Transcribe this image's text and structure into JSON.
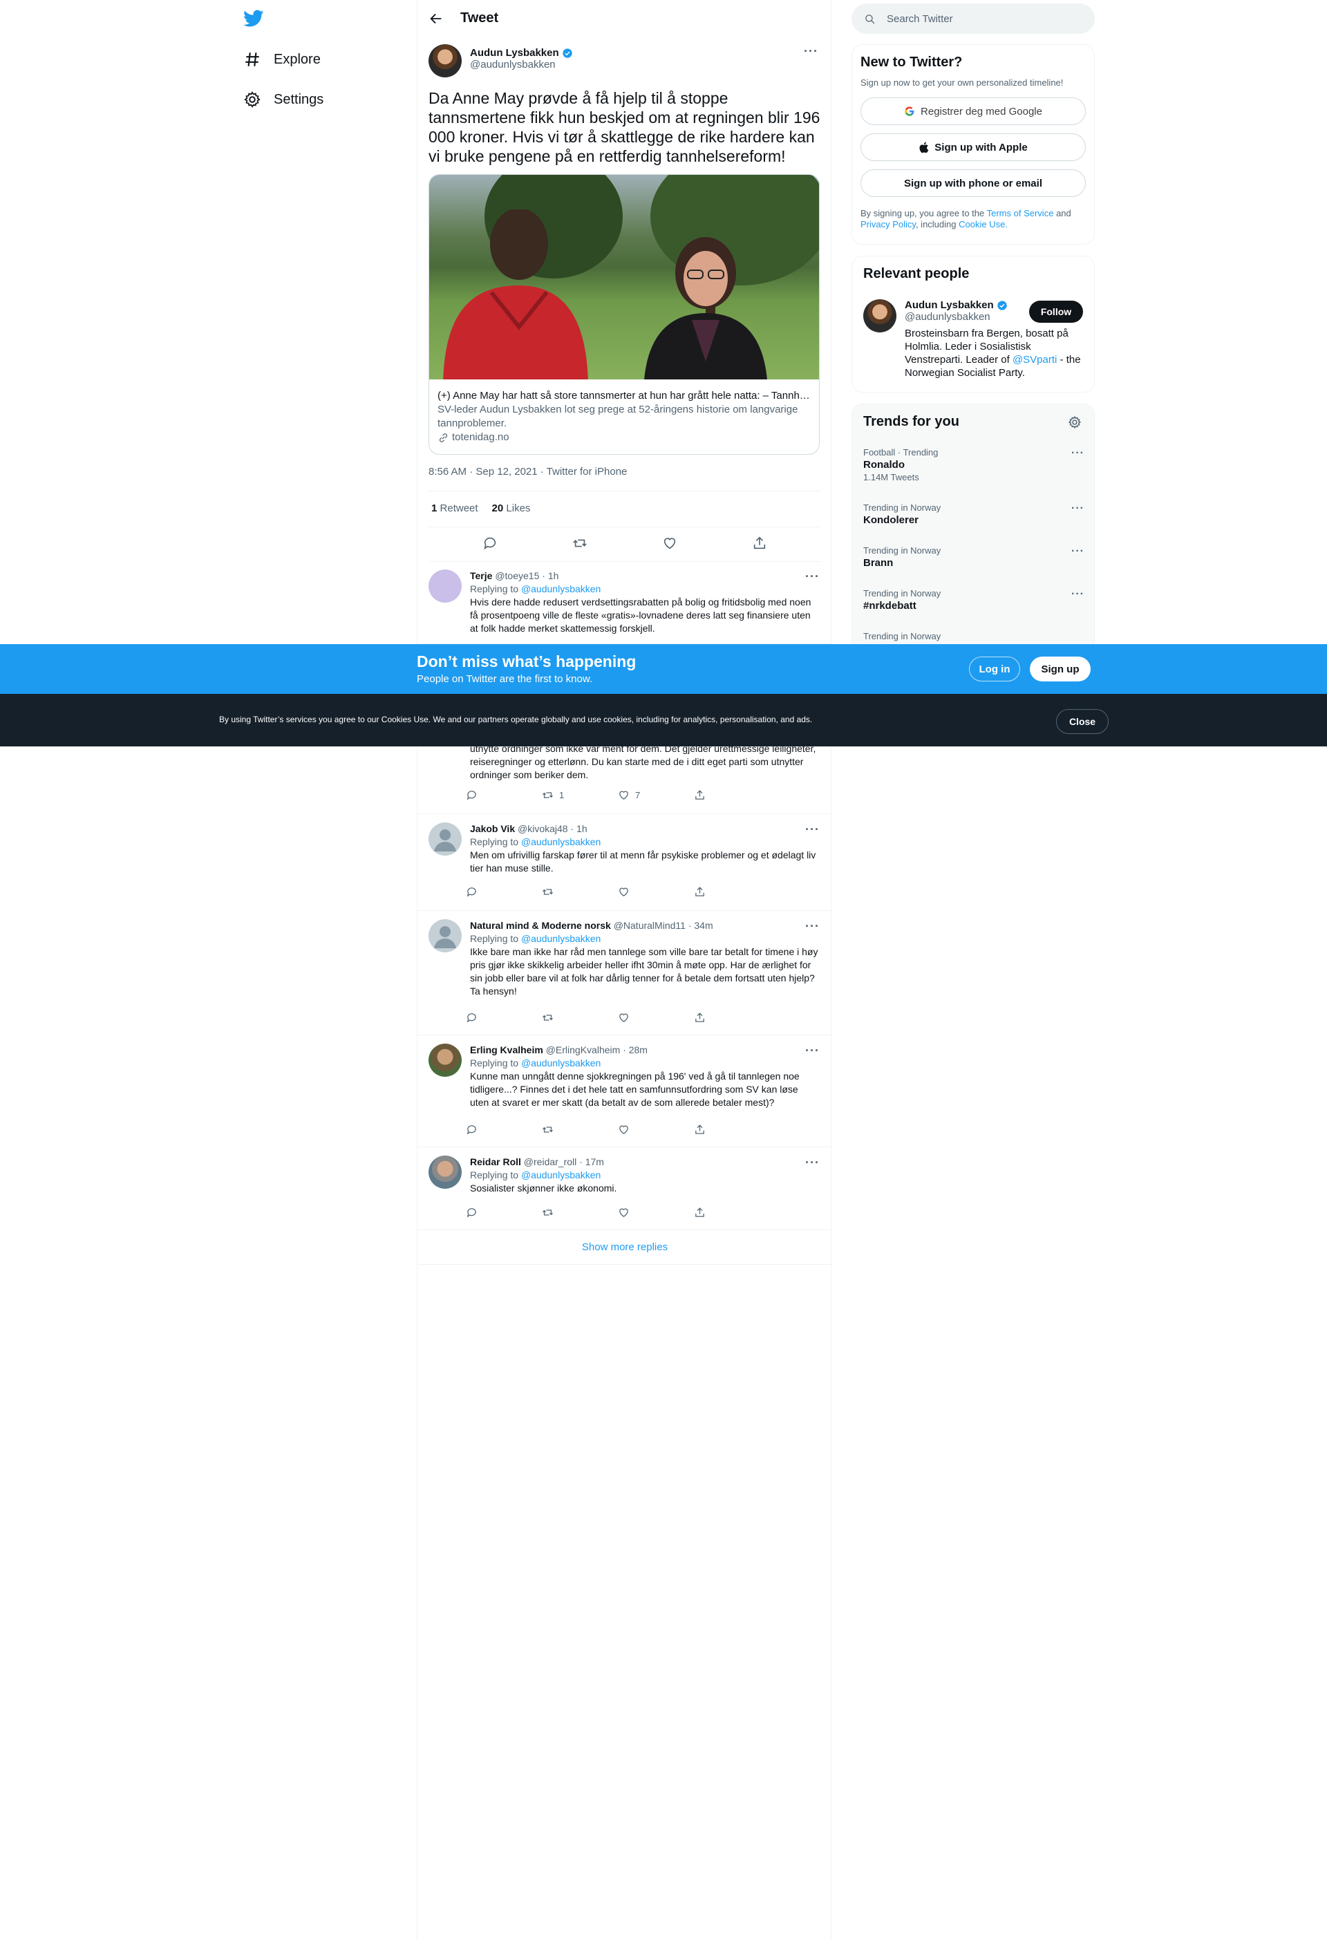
{
  "nav": {
    "explore": "Explore",
    "settings": "Settings"
  },
  "header": {
    "title": "Tweet"
  },
  "tweet": {
    "author_name": "Audun Lysbakken",
    "author_handle": "@audunlysbakken",
    "text": "Da Anne May prøvde å få hjelp til å stoppe tannsmertene fikk hun beskjed om at regningen blir 196 000 kroner. Hvis vi tør å skattlegge de rike hardere kan vi bruke pengene på en rettferdig tannhelsereform!",
    "card": {
      "title": "(+) Anne May har hatt så store tannsmerter at hun har grått hele natta: – Tannhelsa er blitt et klassesymbol",
      "description": "SV-leder Audun Lysbakken lot seg prege at 52-åringens historie om langvarige tannproblemer.",
      "domain": "totenidag.no"
    },
    "meta": "8:56 AM · Sep 12, 2021 · Twitter for iPhone",
    "retweets_count": "1",
    "retweets_label": "Retweet",
    "likes_count": "20",
    "likes_label": "Likes"
  },
  "replying_to_label": "Replying to",
  "replies": [
    {
      "name": "Terje",
      "handle": "@toeye15",
      "time": "· 1h",
      "replying_to": "@audunlysbakken",
      "text": "Hvis dere hadde redusert verdsettingsrabatten på bolig og fritidsbolig med noen få prosentpoeng ville de fleste «gratis»-lovnadene deres latt seg finansiere uten at folk hadde merket skattemessig forskjell."
    },
    {
      "text_partial": "utnytte ordninger som ikke var ment for dem. Det gjelder urettmessige leiligheter, reiseregninger og etterlønn. Du kan starte med de i ditt eget parti som utnytter ordninger som beriker dem.",
      "retweets": "1",
      "likes": "7"
    },
    {
      "name": "Jakob Vik",
      "handle": "@kivokaj48",
      "time": "· 1h",
      "replying_to": "@audunlysbakken",
      "text": "Men om ufrivillig farskap fører til at menn får psykiske  problemer og et ødelagt liv tier han muse stille."
    },
    {
      "name": "Natural mind & Moderne norsk",
      "handle": "@NaturalMind11",
      "time": "· 34m",
      "replying_to": "@audunlysbakken",
      "text": "Ikke bare man ikke har råd men tannlege som ville bare tar betalt for timene i høy pris gjør ikke skikkelig arbeider heller ifht 30min å møte opp. Har de ærlighet for sin jobb eller bare vil at folk har dårlig tenner for å betale dem fortsatt uten hjelp? Ta hensyn!"
    },
    {
      "name": "Erling Kvalheim",
      "handle": "@ErlingKvalheim",
      "time": "· 28m",
      "replying_to": "@audunlysbakken",
      "text": "Kunne man unngått denne sjokkregningen på 196' ved å gå til tannlegen noe tidligere...? Finnes det i det hele tatt en samfunnsutfordring som SV kan løse uten at svaret er mer skatt (da betalt av de som allerede betaler mest)?"
    },
    {
      "name": "Reidar Roll",
      "handle": "@reidar_roll",
      "time": "· 17m",
      "replying_to": "@audunlysbakken",
      "text": "Sosialister skjønner ikke økonomi."
    }
  ],
  "show_more": "Show more replies",
  "search": {
    "placeholder": "Search Twitter"
  },
  "new_to_twitter": {
    "title": "New to Twitter?",
    "subtitle": "Sign up now to get your own personalized timeline!",
    "google": "Registrer deg med Google",
    "apple": "Sign up with Apple",
    "phone": "Sign up with phone or email",
    "legal_1": "By signing up, you agree to the",
    "terms": "Terms of Service",
    "and": "and",
    "privacy": "Privacy Policy",
    "including": ", including",
    "cookie": "Cookie Use."
  },
  "relevant": {
    "title": "Relevant people",
    "name": "Audun Lysbakken",
    "handle": "@audunlysbakken",
    "follow": "Follow",
    "bio_1": "Brosteinsbarn fra Bergen, bosatt på Holmlia. Leder i Sosialistisk Venstreparti. Leader of",
    "bio_link": "@SVparti",
    "bio_2": "- the Norwegian Socialist Party."
  },
  "trends": {
    "title": "Trends for you",
    "items": [
      {
        "category": "Football · Trending",
        "name": "Ronaldo",
        "count": "1.14M Tweets"
      },
      {
        "category": "Trending in Norway",
        "name": "Kondolerer"
      },
      {
        "category": "Trending in Norway",
        "name": "Brann"
      },
      {
        "category": "Trending in Norway",
        "name": "#nrkdebatt"
      },
      {
        "category": "Trending in Norway"
      }
    ]
  },
  "signup_bar": {
    "heading": "Don’t miss what’s happening",
    "sub": "People on Twitter are the first to know.",
    "login": "Log in",
    "signup": "Sign up"
  },
  "cookie_bar": {
    "text": "By using Twitter’s services you agree to our Cookies Use. We and our partners operate globally and use cookies, including for analytics, personalisation, and ads.",
    "close": "Close"
  },
  "colors": {
    "accent": "#1d9bf0",
    "text": "#0f1419",
    "secondary": "#536471",
    "cookie_bg": "#15202b"
  }
}
